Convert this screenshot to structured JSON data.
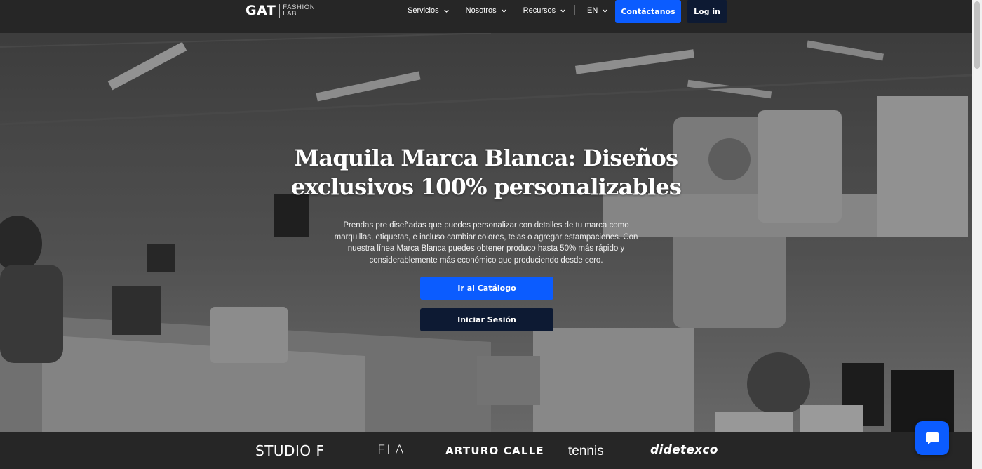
{
  "nav": {
    "logo_main": "GAT",
    "logo_sub_line1": "FASHION",
    "logo_sub_line2": "LAB.",
    "menu": [
      {
        "label": "Servicios"
      },
      {
        "label": "Nosotros"
      },
      {
        "label": "Recursos"
      }
    ],
    "language": "EN",
    "contact_label": "Contáctanos",
    "login_label": "Log in"
  },
  "hero": {
    "title": "Maquila Marca Blanca: Diseños exclusivos 100% personalizables",
    "description": "Prendas pre diseñadas que puedes personalizar con detalles de tu marca como marquillas, etiquetas, e incluso cambiar colores, telas o agregar estampaciones. Con nuestra línea Marca Blanca puedes obtener produco hasta 50% más rápido y considerablemente más económico que produciendo desde cero.",
    "catalog_button": "Ir al Catálogo",
    "session_button": "Iniciar Sesión"
  },
  "brands": [
    "STUDIO F",
    "ELA",
    "ARTURO CALLE",
    "tennis",
    "didetexco"
  ],
  "colors": {
    "accent": "#0b5cff",
    "dark_button": "#0d1a33",
    "nav_bg": "#262626"
  },
  "icons": {
    "dropdown": "chevron-down-icon",
    "chat": "chat-bubble-icon"
  }
}
